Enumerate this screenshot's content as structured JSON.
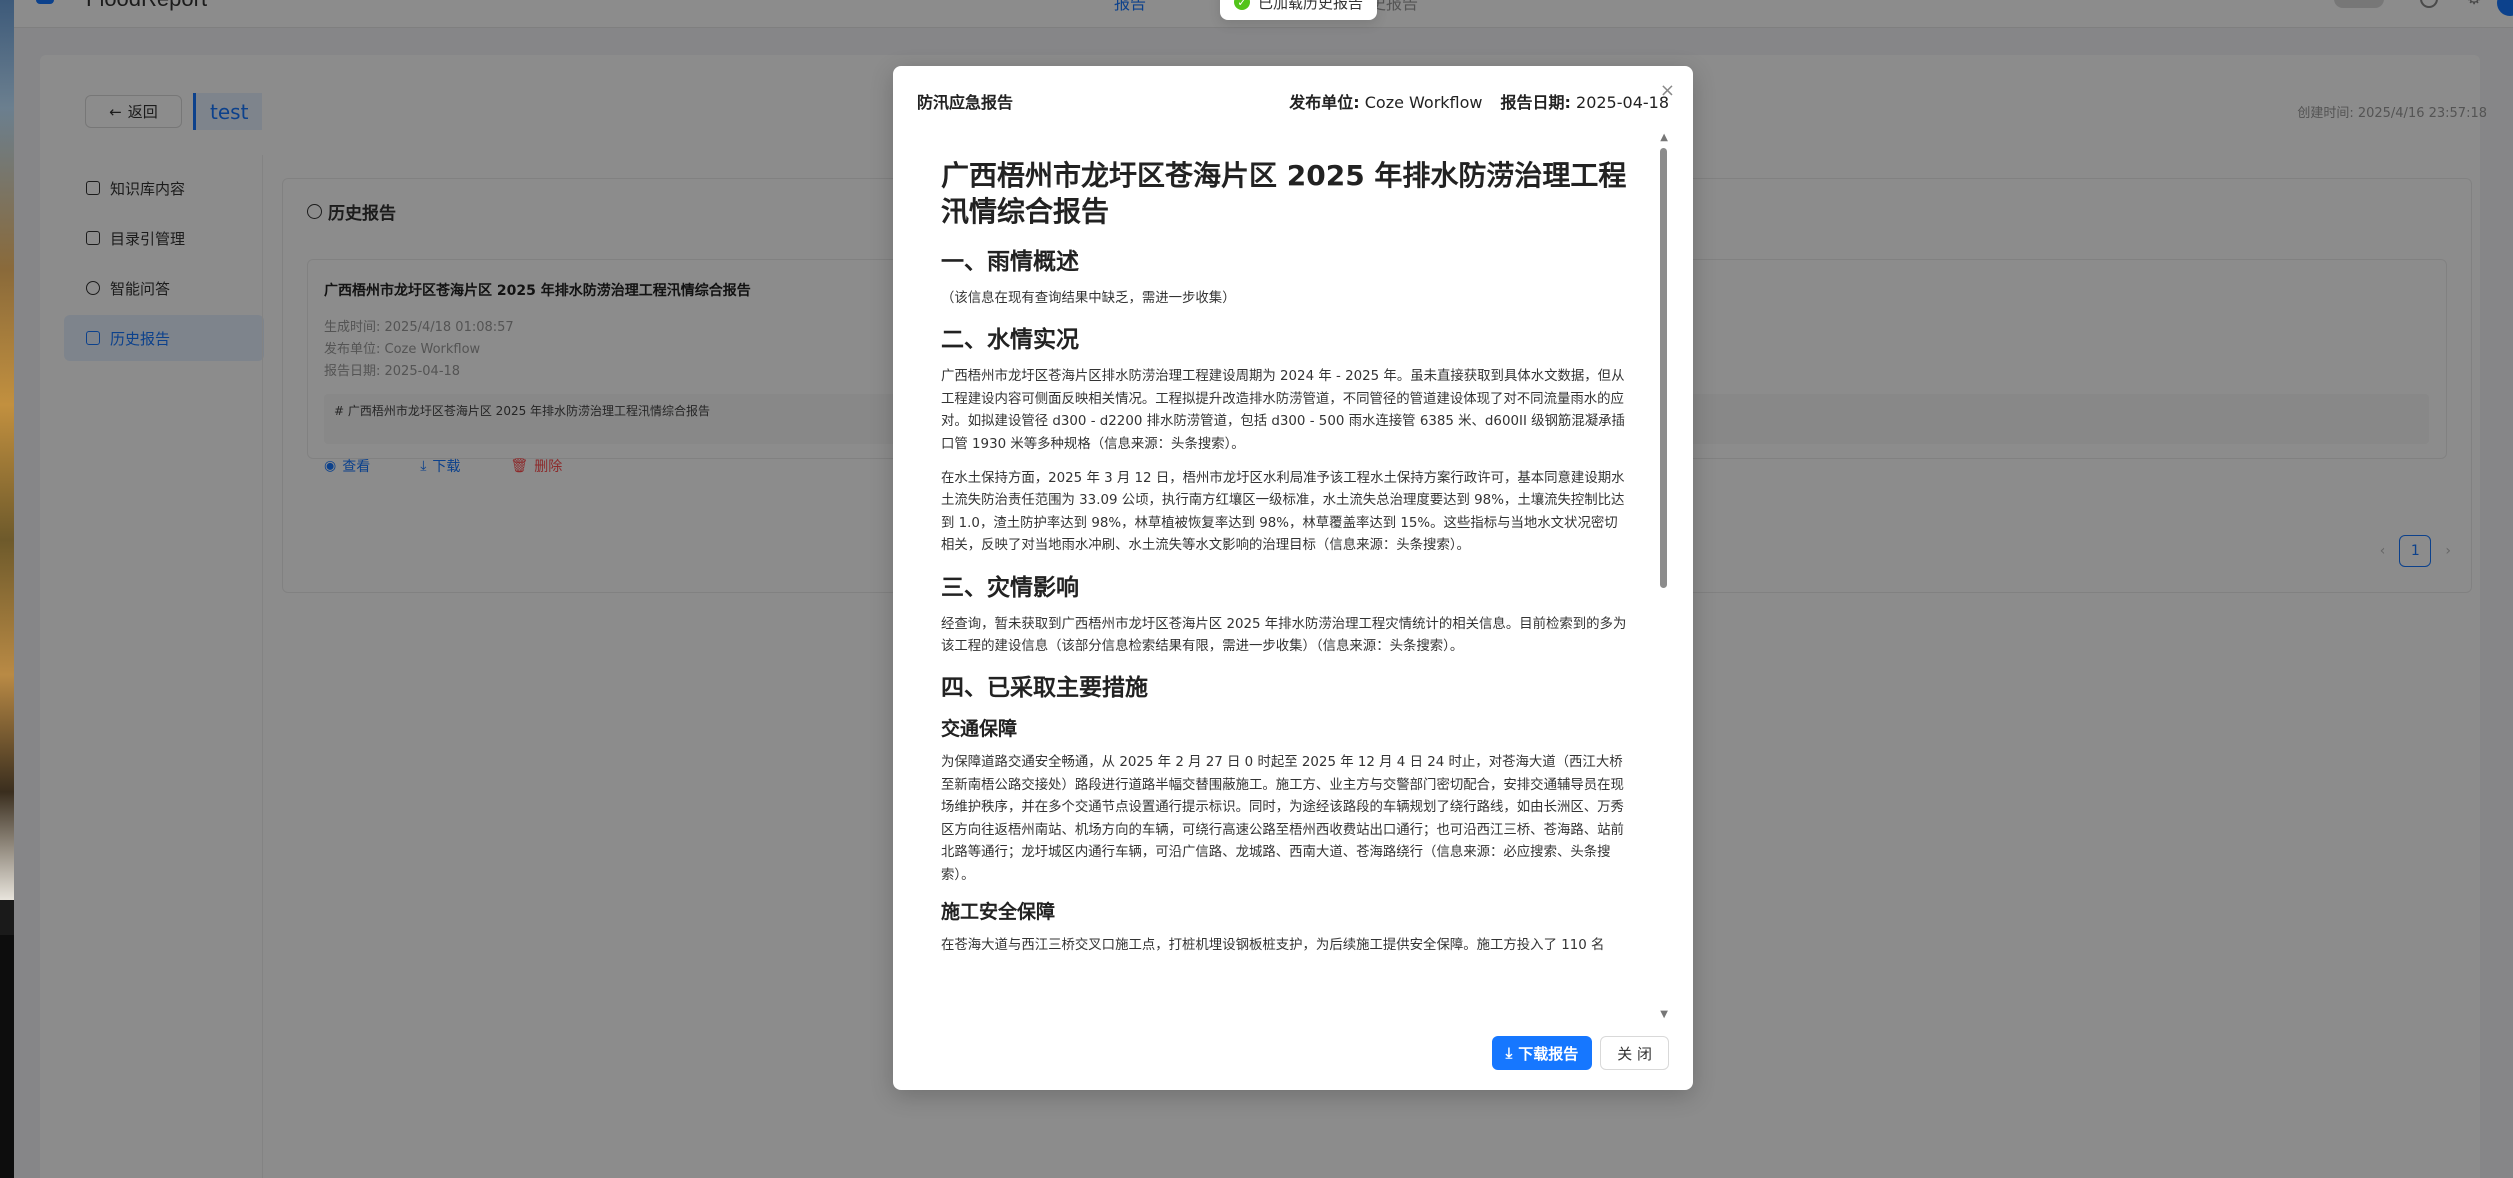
{
  "app": {
    "brand": "FloodReport",
    "nav_active": "报告",
    "nav_other": "历史报告"
  },
  "toast": {
    "text": "已加载历史报告"
  },
  "header": {
    "back_label": "返回",
    "kb_name": "test",
    "created": "创建时间: 2025/4/16 23:57:18"
  },
  "sidebar": {
    "items": [
      {
        "label": "知识库内容"
      },
      {
        "label": "目录引管理"
      },
      {
        "label": "智能问答"
      },
      {
        "label": "历史报告"
      }
    ]
  },
  "panel": {
    "title": "历史报告",
    "card": {
      "title": "广西梧州市龙圩区苍海片区 2025 年排水防涝治理工程汛情综合报告",
      "generated": "生成时间: 2025/4/18 01:08:57",
      "publisher": "发布单位: Coze Workflow",
      "date": "报告日期: 2025-04-18",
      "preview": "# 广西梧州市龙圩区苍海片区 2025 年排水防涝治理工程汛情综合报告",
      "view": "查看",
      "download": "下载",
      "delete": "删除"
    },
    "page": "1"
  },
  "modal": {
    "title": "防汛应急报告",
    "publisher_label": "发布单位:",
    "publisher": "Coze Workflow",
    "date_label": "报告日期:",
    "date": "2025-04-18",
    "download_label": "下载报告",
    "close_label": "关 闭",
    "doc": {
      "h1": "广西梧州市龙圩区苍海片区 2025 年排水防涝治理工程汛情综合报告",
      "s1": "一、雨情概述",
      "p1": "（该信息在现有查询结果中缺乏，需进一步收集）",
      "s2": "二、水情实况",
      "p2": "广西梧州市龙圩区苍海片区排水防涝治理工程建设周期为 2024 年 - 2025 年。虽未直接获取到具体水文数据，但从工程建设内容可侧面反映相关情况。工程拟提升改造排水防涝管道，不同管径的管道建设体现了对不同流量雨水的应对。如拟建设管径 d300 - d2200 排水防涝管道，包括 d300 - 500 雨水连接管 6385 米、d600II 级钢筋混凝承插口管 1930 米等多种规格（信息来源：头条搜索）。",
      "p3": "在水土保持方面，2025 年 3 月 12 日，梧州市龙圩区水利局准予该工程水土保持方案行政许可，基本同意建设期水土流失防治责任范围为 33.09 公顷，执行南方红壤区一级标准，水土流失总治理度要达到 98%，土壤流失控制比达到 1.0，渣土防护率达到 98%，林草植被恢复率达到 98%，林草覆盖率达到 15%。这些指标与当地水文状况密切相关，反映了对当地雨水冲刷、水土流失等水文影响的治理目标（信息来源：头条搜索）。",
      "s3": "三、灾情影响",
      "p4": "经查询，暂未获取到广西梧州市龙圩区苍海片区 2025 年排水防涝治理工程灾情统计的相关信息。目前检索到的多为该工程的建设信息（该部分信息检索结果有限，需进一步收集）（信息来源：头条搜索）。",
      "s4": "四、已采取主要措施",
      "h_traffic": "交通保障",
      "p5": "为保障道路交通安全畅通，从 2025 年 2 月 27 日 0 时起至 2025 年 12 月 4 日 24 时止，对苍海大道（西江大桥至新南梧公路交接处）路段进行道路半幅交替围蔽施工。施工方、业主方与交警部门密切配合，安排交通辅导员在现场维护秩序，并在多个交通节点设置通行提示标识。同时，为途经该路段的车辆规划了绕行路线，如由长洲区、万秀区方向往返梧州南站、机场方向的车辆，可绕行高速公路至梧州西收费站出口通行；也可沿西江三桥、苍海路、站前北路等通行；龙圩城区内通行车辆，可沿广信路、龙城路、西南大道、苍海路绕行（信息来源：必应搜索、头条搜索）。",
      "h_safety": "施工安全保障",
      "p6": "在苍海大道与西江三桥交叉口施工点，打桩机埋设钢板桩支护，为后续施工提供安全保障。施工方投入了 110 名"
    }
  }
}
